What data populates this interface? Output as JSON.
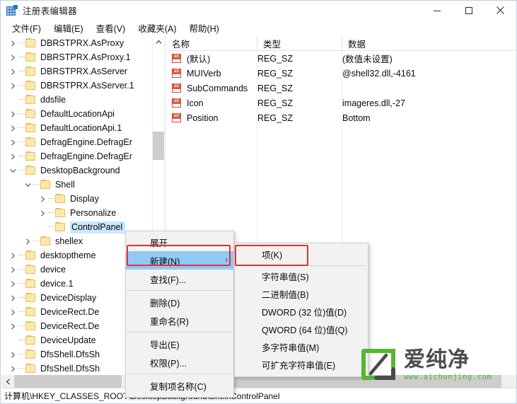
{
  "window": {
    "title": "注册表编辑器",
    "icon": "registry-grid-icon",
    "controls": [
      {
        "name": "minimize",
        "glyph": "—"
      },
      {
        "name": "maximize",
        "glyph": "▢"
      },
      {
        "name": "close",
        "glyph": "✕"
      }
    ]
  },
  "menubar": {
    "items": [
      {
        "label": "文件(F)"
      },
      {
        "label": "编辑(E)"
      },
      {
        "label": "查看(V)"
      },
      {
        "label": "收藏夹(A)"
      },
      {
        "label": "帮助(H)"
      }
    ]
  },
  "tree": {
    "nodes": [
      {
        "label": "DBRSTPRX.AsProxy",
        "indent": 0,
        "state": "collapsed",
        "selected": false
      },
      {
        "label": "DBRSTPRX.AsProxy.1",
        "indent": 0,
        "state": "collapsed",
        "selected": false
      },
      {
        "label": "DBRSTPRX.AsServer",
        "indent": 0,
        "state": "collapsed",
        "selected": false
      },
      {
        "label": "DBRSTPRX.AsServer.1",
        "indent": 0,
        "state": "collapsed",
        "selected": false
      },
      {
        "label": "ddsfile",
        "indent": 0,
        "state": "leaf",
        "selected": false
      },
      {
        "label": "DefaultLocationApi",
        "indent": 0,
        "state": "collapsed",
        "selected": false
      },
      {
        "label": "DefaultLocationApi.1",
        "indent": 0,
        "state": "collapsed",
        "selected": false
      },
      {
        "label": "DefragEngine.DefragEr",
        "indent": 0,
        "state": "collapsed",
        "selected": false
      },
      {
        "label": "DefragEngine.DefragEr",
        "indent": 0,
        "state": "collapsed",
        "selected": false
      },
      {
        "label": "DesktopBackground",
        "indent": 0,
        "state": "expanded",
        "selected": false
      },
      {
        "label": "Shell",
        "indent": 1,
        "state": "expanded",
        "selected": false
      },
      {
        "label": "Display",
        "indent": 2,
        "state": "collapsed",
        "selected": false
      },
      {
        "label": "Personalize",
        "indent": 2,
        "state": "collapsed",
        "selected": false
      },
      {
        "label": "ControlPanel",
        "indent": 2,
        "state": "leaf",
        "selected": true
      },
      {
        "label": "shellex",
        "indent": 1,
        "state": "collapsed",
        "selected": false
      },
      {
        "label": "desktoptheme",
        "indent": 0,
        "state": "collapsed",
        "selected": false
      },
      {
        "label": "device",
        "indent": 0,
        "state": "collapsed",
        "selected": false
      },
      {
        "label": "device.1",
        "indent": 0,
        "state": "collapsed",
        "selected": false
      },
      {
        "label": "DeviceDisplay",
        "indent": 0,
        "state": "collapsed",
        "selected": false
      },
      {
        "label": "DeviceRect.De",
        "indent": 0,
        "state": "collapsed",
        "selected": false
      },
      {
        "label": "DeviceRect.De",
        "indent": 0,
        "state": "collapsed",
        "selected": false
      },
      {
        "label": "DeviceUpdate",
        "indent": 0,
        "state": "leaf",
        "selected": false
      },
      {
        "label": "DfsShell.DfsSh",
        "indent": 0,
        "state": "collapsed",
        "selected": false
      },
      {
        "label": "DfsShell.DfsSh",
        "indent": 0,
        "state": "collapsed",
        "selected": false
      }
    ]
  },
  "list": {
    "columns": [
      {
        "label": "名称"
      },
      {
        "label": "类型"
      },
      {
        "label": "数据"
      }
    ],
    "rows": [
      {
        "icon": "ab-string-icon",
        "name": "(默认)",
        "type": "REG_SZ",
        "data": "(数值未设置)"
      },
      {
        "icon": "ab-string-icon",
        "name": "MUIVerb",
        "type": "REG_SZ",
        "data": "@shell32.dll,-4161"
      },
      {
        "icon": "ab-string-icon",
        "name": "SubCommands",
        "type": "REG_SZ",
        "data": ""
      },
      {
        "icon": "ab-string-icon",
        "name": "Icon",
        "type": "REG_SZ",
        "data": "imageres.dll,-27"
      },
      {
        "icon": "ab-string-icon",
        "name": "Position",
        "type": "REG_SZ",
        "data": "Bottom"
      }
    ]
  },
  "context_menu": {
    "items": [
      {
        "label": "展开",
        "highlighted": false,
        "submenu": false,
        "sep_after": false
      },
      {
        "label": "新建(N)",
        "highlighted": true,
        "submenu": true,
        "sep_after": false
      },
      {
        "label": "查找(F)...",
        "highlighted": false,
        "submenu": false,
        "sep_after": true
      },
      {
        "label": "删除(D)",
        "highlighted": false,
        "submenu": false,
        "sep_after": false
      },
      {
        "label": "重命名(R)",
        "highlighted": false,
        "submenu": false,
        "sep_after": true
      },
      {
        "label": "导出(E)",
        "highlighted": false,
        "submenu": false,
        "sep_after": false
      },
      {
        "label": "权限(P)...",
        "highlighted": false,
        "submenu": false,
        "sep_after": true
      },
      {
        "label": "复制项名称(C)",
        "highlighted": false,
        "submenu": false,
        "sep_after": false
      }
    ]
  },
  "submenu": {
    "items": [
      {
        "label": "项(K)",
        "sep_after": true
      },
      {
        "label": "字符串值(S)",
        "sep_after": false
      },
      {
        "label": "二进制值(B)",
        "sep_after": false
      },
      {
        "label": "DWORD (32 位)值(D)",
        "sep_after": false
      },
      {
        "label": "QWORD (64 位)值(Q)",
        "sep_after": false
      },
      {
        "label": "多字符串值(M)",
        "sep_after": false
      },
      {
        "label": "可扩充字符串值(E)",
        "sep_after": false
      }
    ]
  },
  "statusbar": {
    "path": "计算机\\HKEY_CLASSES_ROOT\\DesktopBackground\\Shell\\ControlPanel"
  },
  "watermark": {
    "brand": "爱纯净",
    "url": "www.aichunjing.com",
    "color": "#56b631"
  },
  "annotations": {
    "highlight_color": "#e0342c",
    "selection_color": "#cde8ff",
    "menu_highlight_color": "#91c9f7"
  }
}
